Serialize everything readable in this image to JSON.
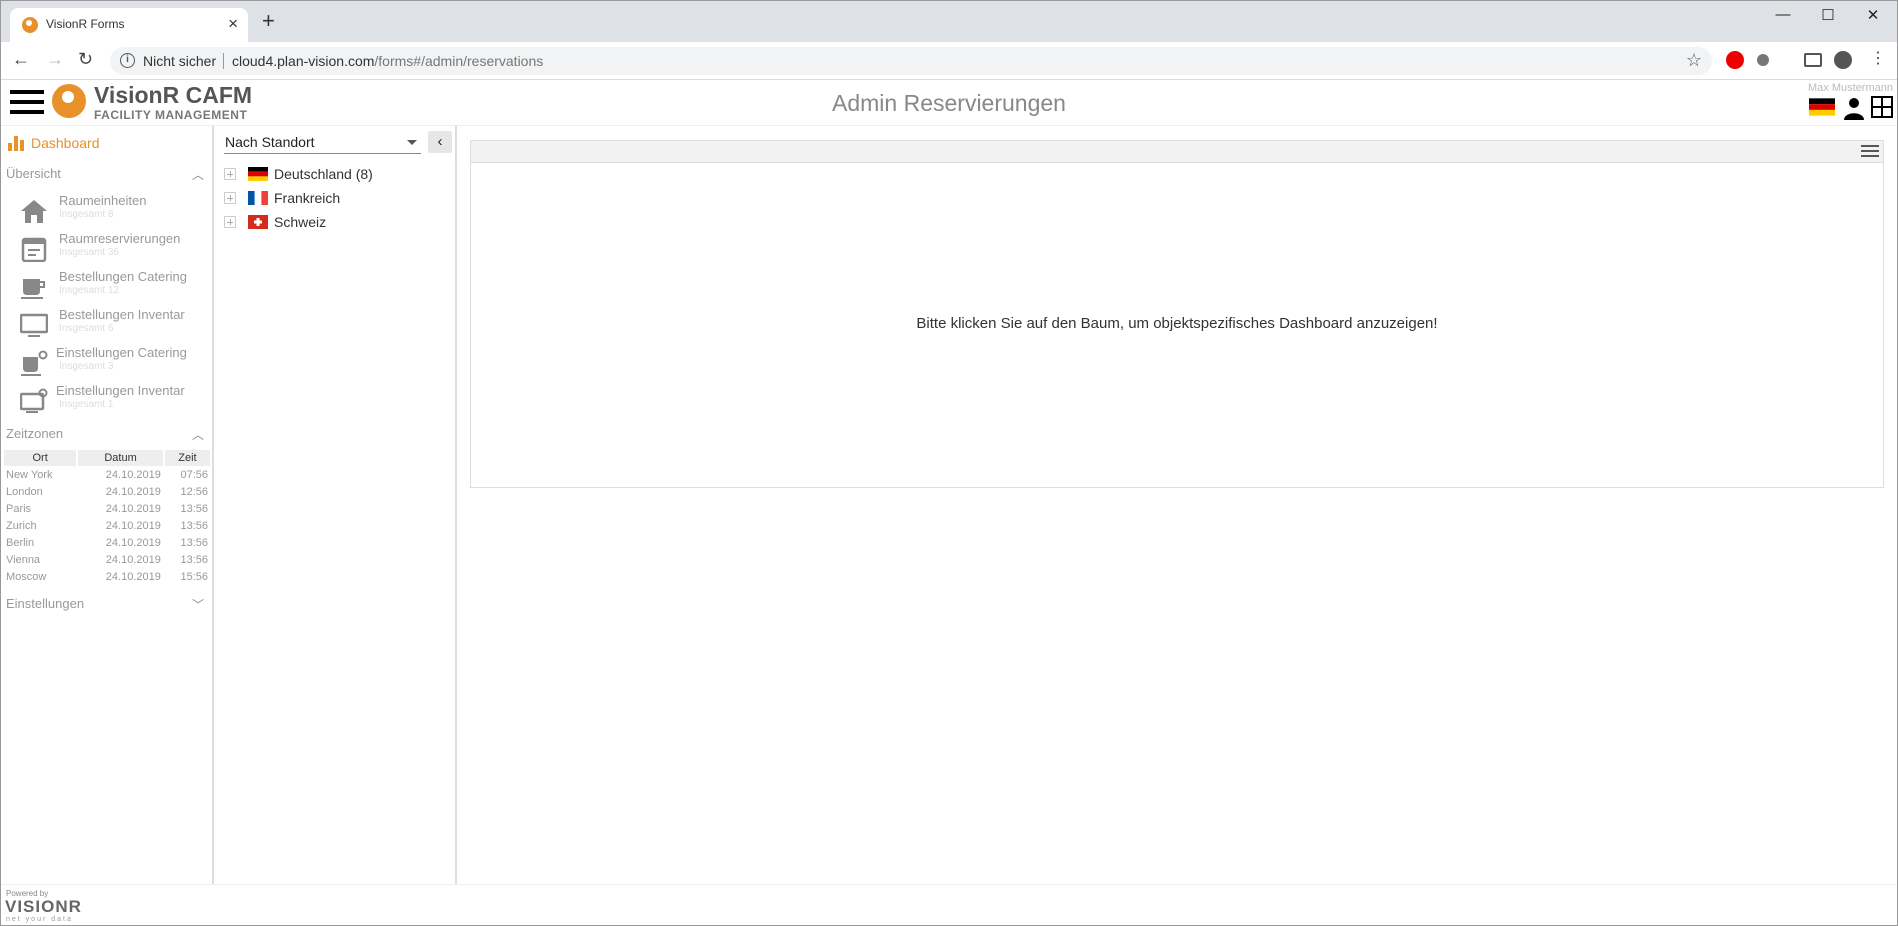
{
  "browser": {
    "tab_title": "VisionR Forms",
    "not_secure": "Nicht sicher",
    "url_host": "cloud4.plan-vision.com",
    "url_path": "/forms#/admin/reservations"
  },
  "app": {
    "brand": "VisionR CAFM",
    "brand_sub": "FACILITY MANAGEMENT",
    "page_title": "Admin Reservierungen",
    "username": "Max Mustermann"
  },
  "sidebar": {
    "dashboard": "Dashboard",
    "overview_title": "Übersicht",
    "items": [
      {
        "label": "Raumeinheiten",
        "sub": "Insgesamt 8",
        "icon": "home-icon"
      },
      {
        "label": "Raumreservierungen",
        "sub": "Insgesamt 36",
        "icon": "calendar-icon"
      },
      {
        "label": "Bestellungen Catering",
        "sub": "Insgesamt 12",
        "icon": "cup-icon"
      },
      {
        "label": "Bestellungen Inventar",
        "sub": "Insgesamt 6",
        "icon": "monitor-icon"
      },
      {
        "label": "Einstellungen Catering",
        "sub": "Insgesamt 3",
        "icon": "cup-gear-icon"
      },
      {
        "label": "Einstellungen Inventar",
        "sub": "Insgesamt 1",
        "icon": "monitor-gear-icon"
      }
    ],
    "timezones_title": "Zeitzonen",
    "tz_headers": [
      "Ort",
      "Datum",
      "Zeit"
    ],
    "tz_rows": [
      [
        "New York",
        "24.10.2019",
        "07:56"
      ],
      [
        "London",
        "24.10.2019",
        "12:56"
      ],
      [
        "Paris",
        "24.10.2019",
        "13:56"
      ],
      [
        "Zurich",
        "24.10.2019",
        "13:56"
      ],
      [
        "Berlin",
        "24.10.2019",
        "13:56"
      ],
      [
        "Vienna",
        "24.10.2019",
        "13:56"
      ],
      [
        "Moscow",
        "24.10.2019",
        "15:56"
      ]
    ],
    "settings_title": "Einstellungen"
  },
  "tree": {
    "select_value": "Nach Standort",
    "items": [
      {
        "label": "Deutschland (8)",
        "flag": "flag-de-icon"
      },
      {
        "label": "Frankreich",
        "flag": "flag-fr-icon"
      },
      {
        "label": "Schweiz",
        "flag": "flag-ch-icon"
      }
    ]
  },
  "main": {
    "message": "Bitte klicken Sie auf den Baum, um objektspezifisches Dashboard anzuzeigen!"
  },
  "footer": {
    "powered_by": "Powered by",
    "logo": "VISIONR",
    "tagline": "net your data"
  },
  "colors": {
    "accent": "#e8902a",
    "muted_text": "#999999"
  }
}
